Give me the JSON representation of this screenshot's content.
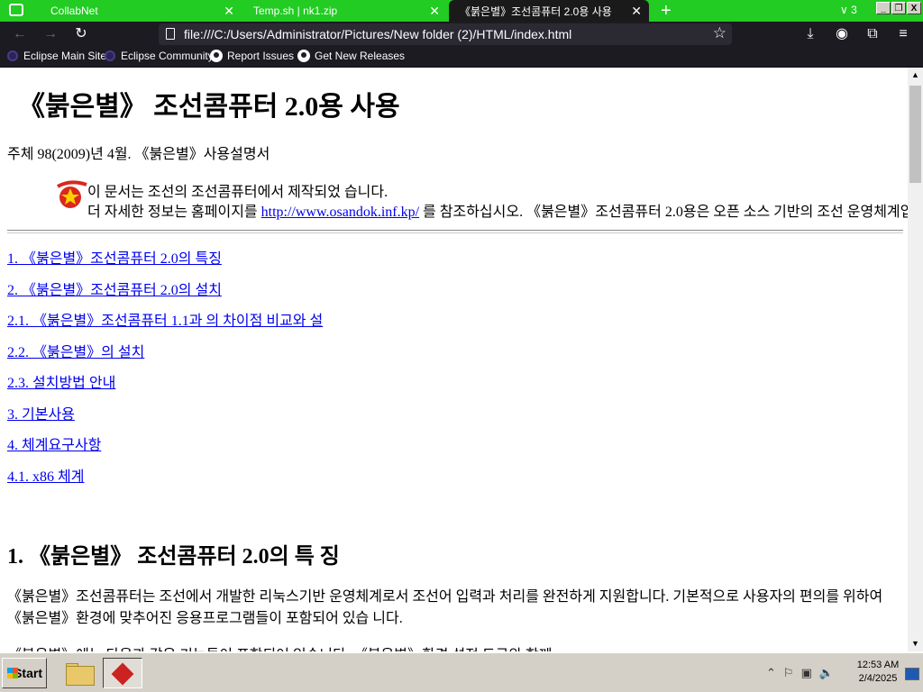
{
  "browser": {
    "tabs": [
      {
        "label": "CollabNet",
        "active": false
      },
      {
        "label": "Temp.sh | nk1.zip",
        "active": false
      },
      {
        "label": "《붉은별》조선콤퓨터 2.0용 사용",
        "active": true
      }
    ],
    "tab_count": "3",
    "window_controls": {
      "minimize": "_",
      "restore": "❐",
      "close": "X"
    },
    "address": "file:///C:/Users/Administrator/Pictures/New folder (2)/HTML/index.html",
    "bookmarks": [
      {
        "label": "Eclipse Main Site",
        "icon": "eclipse-icon"
      },
      {
        "label": "Eclipse Community",
        "icon": "eclipse-icon"
      },
      {
        "label": "Report Issues",
        "icon": "github-icon"
      },
      {
        "label": "Get New Releases",
        "icon": "github-icon"
      }
    ]
  },
  "page": {
    "title": "《붉은별》 조선콤퓨터 2.0용 사용",
    "meta": "주체 98(2009)년 4월. 《붉은별》사용설명서",
    "notice_line1": "이 문서는 조선의 조선콤퓨터에서 제작되었 습니다.",
    "notice_pre_link": "더 자세한 정보는 홈페이지를 ",
    "notice_link": "http://www.osandok.inf.kp/",
    "notice_post_link": " 를 참조하십시오. 《붉은별》조선콤퓨터 2.0용은 오픈 소스 기반의 조선 운영체계입니다.",
    "toc": [
      "1. 《붉은별》조선콤퓨터 2.0의 특징",
      "2. 《붉은별》조선콤퓨터 2.0의 설치",
      "2.1. 《붉은별》조선콤퓨터 1.1과 의 차이점 비교와 설",
      "2.2. 《붉은별》의 설치",
      "2.3. 설치방법 안내",
      "3. 기본사용",
      "4. 체계요구사항",
      "4.1. x86 체계"
    ],
    "section1_heading": "1. 《붉은별》 조선콤퓨터 2.0의 특 징",
    "section1_para": "《붉은별》조선콤퓨터는 조선에서 개발한 리눅스기반 운영체계로서 조선어 입력과 처리를 완전하게 지원합니다. 기본적으로 사용자의 편의를 위하여 《붉은별》환경에 맞추어진 응용프로그램들이 포함되어 있습 니다.",
    "section1_para2": "《붉은별》에는 다음과 같은 기능들이 포함되어 있습니다. 《붉은별》환경 설정 도구와 함께"
  },
  "taskbar": {
    "start_label": "Start",
    "time": "12:53 AM",
    "date": "2/4/2025"
  },
  "colors": {
    "tabbar": "#22cc22",
    "toolbar": "#1c1b22",
    "link": "#0000ee",
    "taskbar": "#d4d0c8"
  }
}
